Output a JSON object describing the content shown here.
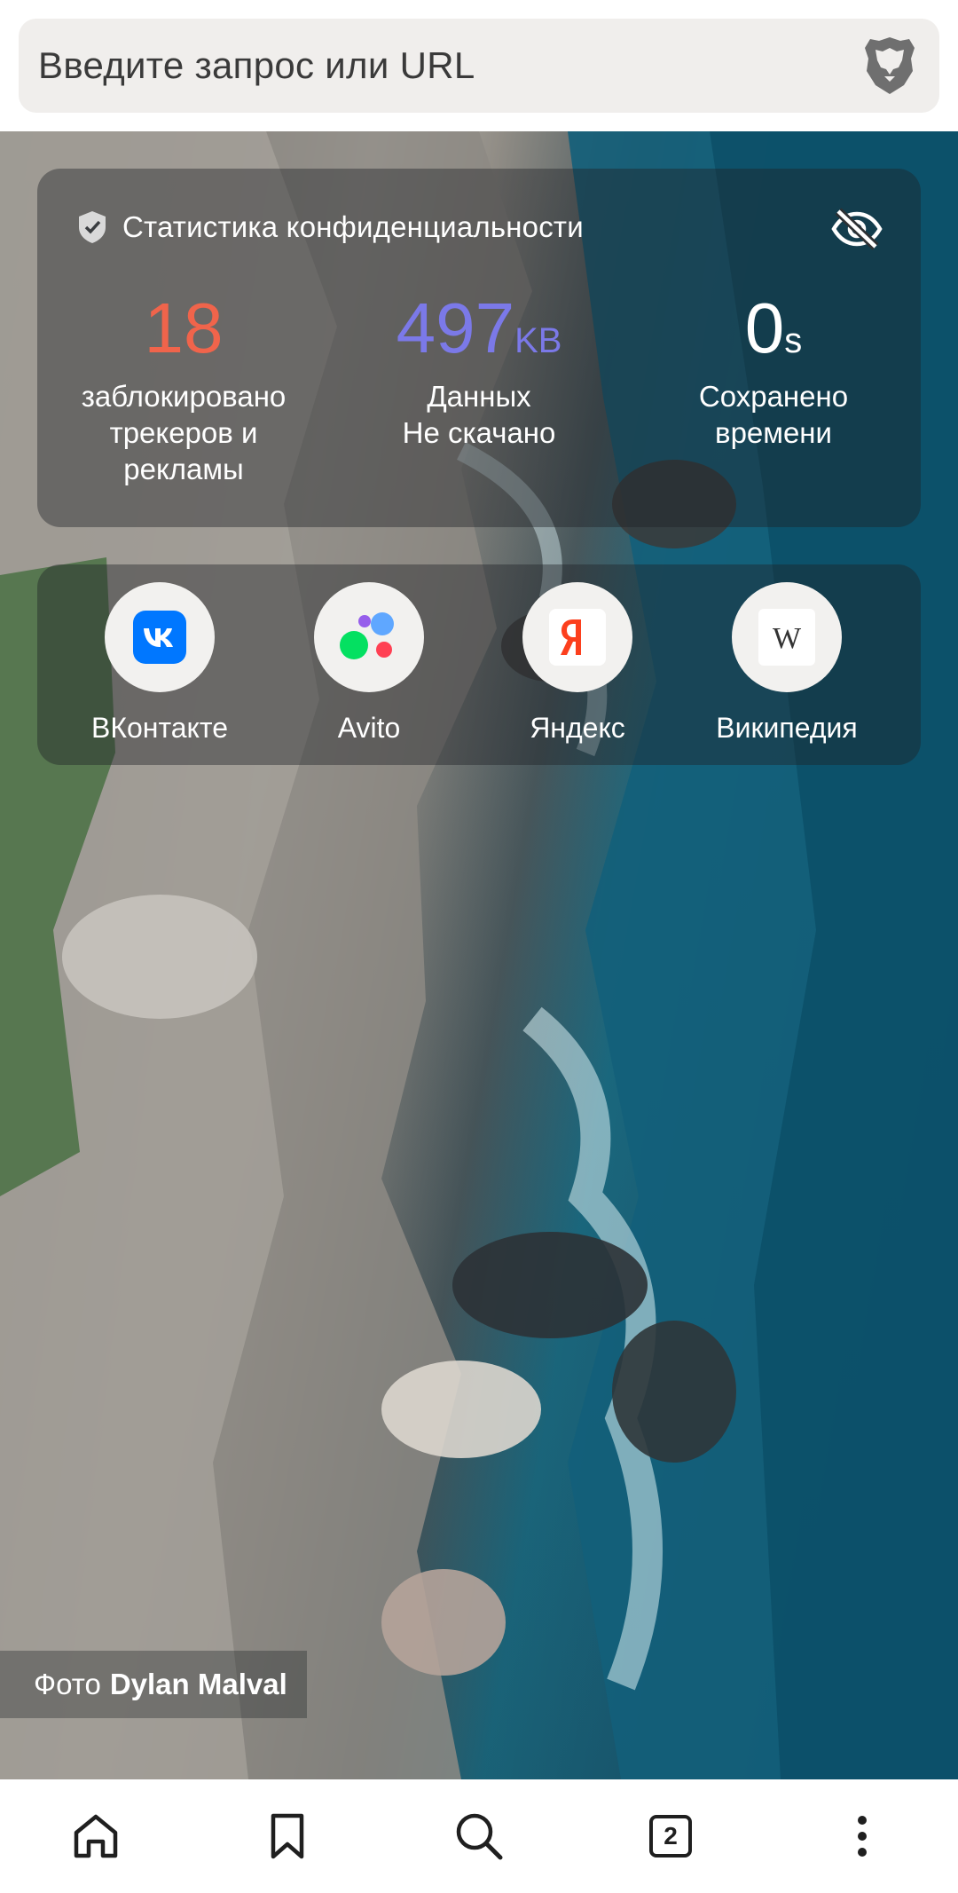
{
  "search": {
    "placeholder": "Введите запрос или URL"
  },
  "privacy_stats": {
    "title": "Статистика конфиденциальности",
    "trackers": {
      "value": "18",
      "unit": "",
      "label": "заблокировано\nтрекеров и\nрекламы",
      "color": "#f0644b"
    },
    "data_saved": {
      "value": "497",
      "unit": "KB",
      "label": "Данных\nНе скачано",
      "color": "#7b79e8"
    },
    "time_saved": {
      "value": "0",
      "unit": "s",
      "label": "Сохранено\nвремени",
      "color": "#ffffff"
    }
  },
  "favorites": [
    {
      "label": "ВКонтакте",
      "icon": "vk-icon"
    },
    {
      "label": "Avito",
      "icon": "avito-icon"
    },
    {
      "label": "Яндекс",
      "icon": "yandex-icon"
    },
    {
      "label": "Википедия",
      "icon": "wikipedia-icon"
    }
  ],
  "photo_credit": {
    "prefix": "Фото",
    "author": "Dylan Malval"
  },
  "bottom_nav": {
    "tabs_count": "2"
  },
  "colors": {
    "vk_blue": "#0077ff",
    "yandex_red": "#fc3f1d",
    "brave_orange": "#fb542b"
  }
}
